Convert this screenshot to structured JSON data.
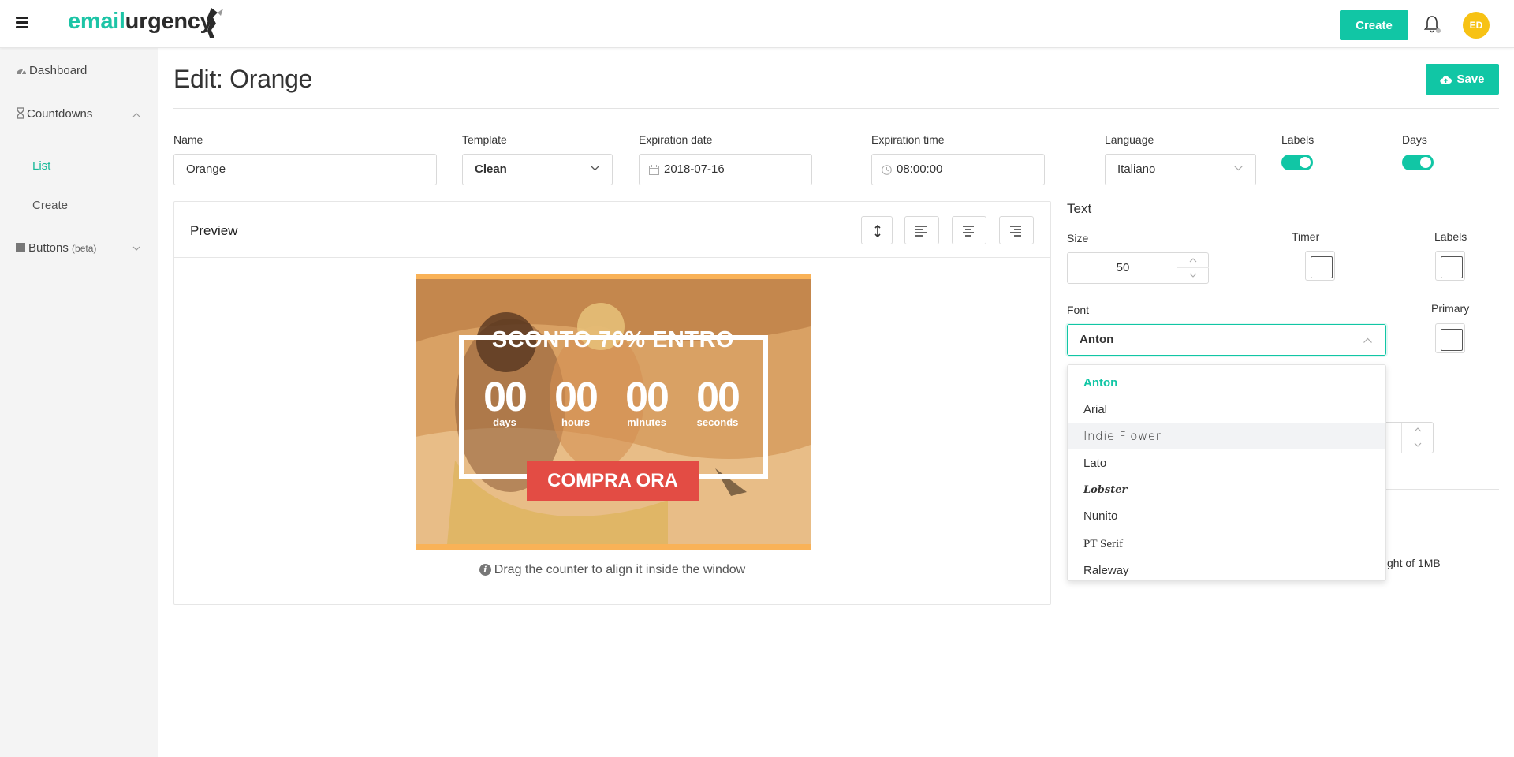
{
  "brand": {
    "name_part1": "email",
    "name_part2": "urgency",
    "accent": "#11c6a5"
  },
  "topbar": {
    "create_label": "Create",
    "avatar_initials": "ED",
    "avatar_color": "#f7c214"
  },
  "sidebar": {
    "items": [
      {
        "label": "Dashboard",
        "icon": "dashboard-icon"
      },
      {
        "label": "Countdowns",
        "icon": "hourglass-icon",
        "expanded": true,
        "children": [
          {
            "label": "List",
            "active": true
          },
          {
            "label": "Create",
            "active": false
          }
        ]
      },
      {
        "label": "Buttons",
        "badge": "(beta)",
        "icon": "square-icon",
        "expanded": false
      }
    ]
  },
  "page": {
    "title": "Edit: Orange",
    "save_label": "Save"
  },
  "form": {
    "name_label": "Name",
    "name_value": "Orange",
    "template_label": "Template",
    "template_value": "Clean",
    "date_label": "Expiration date",
    "date_value": "2018-07-16",
    "time_label": "Expiration time",
    "time_value": "08:00:00",
    "language_label": "Language",
    "language_value": "Italiano",
    "labels_toggle_label": "Labels",
    "labels_toggle_on": true,
    "days_toggle_label": "Days",
    "days_toggle_on": true
  },
  "preview": {
    "title": "Preview",
    "tools": [
      "vertical-align-icon",
      "align-left-icon",
      "align-center-icon",
      "align-right-icon"
    ],
    "headline": "SCONTO 70% ENTRO",
    "counter": [
      {
        "value": "00",
        "label": "days"
      },
      {
        "value": "00",
        "label": "hours"
      },
      {
        "value": "00",
        "label": "minutes"
      },
      {
        "value": "00",
        "label": "seconds"
      }
    ],
    "cta": "COMPRA ORA",
    "cta_color": "#e34c44",
    "hint": "Drag the counter to align it inside the window"
  },
  "text_settings": {
    "section_title": "Text",
    "size_label": "Size",
    "size_value": "50",
    "timer_label": "Timer",
    "labels_label": "Labels",
    "font_label": "Font",
    "font_value": "Anton",
    "primary_label": "Primary",
    "font_options": [
      "Anton",
      "Arial",
      "Indie Flower",
      "Lato",
      "Lobster",
      "Nunito",
      "PT Serif",
      "Raleway"
    ],
    "hovered_option": "Indie Flower",
    "partial_hint": "ght of 1MB"
  }
}
